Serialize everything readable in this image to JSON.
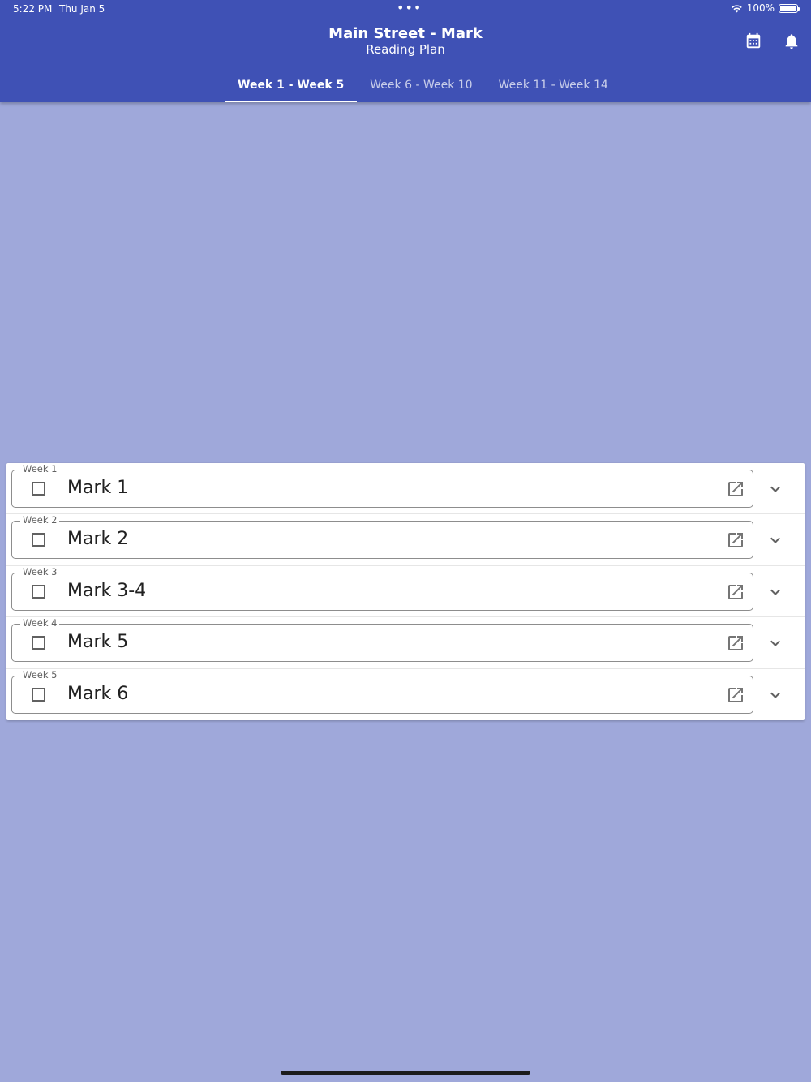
{
  "status_bar": {
    "time": "5:22 PM",
    "date": "Thu Jan 5",
    "dots": "•••",
    "battery": "100%"
  },
  "header": {
    "title": "Main Street - Mark",
    "subtitle": "Reading Plan",
    "calendar_icon": "calendar-icon",
    "bell_icon": "bell-icon"
  },
  "tabs": [
    {
      "label": "Week 1 - Week 5",
      "active": true
    },
    {
      "label": "Week 6 - Week 10",
      "active": false
    },
    {
      "label": "Week 11 - Week 14",
      "active": false
    }
  ],
  "weeks": [
    {
      "week": "Week 1",
      "reading": "Mark 1",
      "checked": false
    },
    {
      "week": "Week 2",
      "reading": "Mark 2",
      "checked": false
    },
    {
      "week": "Week 3",
      "reading": "Mark 3-4",
      "checked": false
    },
    {
      "week": "Week 4",
      "reading": "Mark 5",
      "checked": false
    },
    {
      "week": "Week 5",
      "reading": "Mark 6",
      "checked": false
    }
  ],
  "colors": {
    "appbar": "#3f51b5",
    "background": "#9fa8da",
    "card": "#ffffff"
  }
}
